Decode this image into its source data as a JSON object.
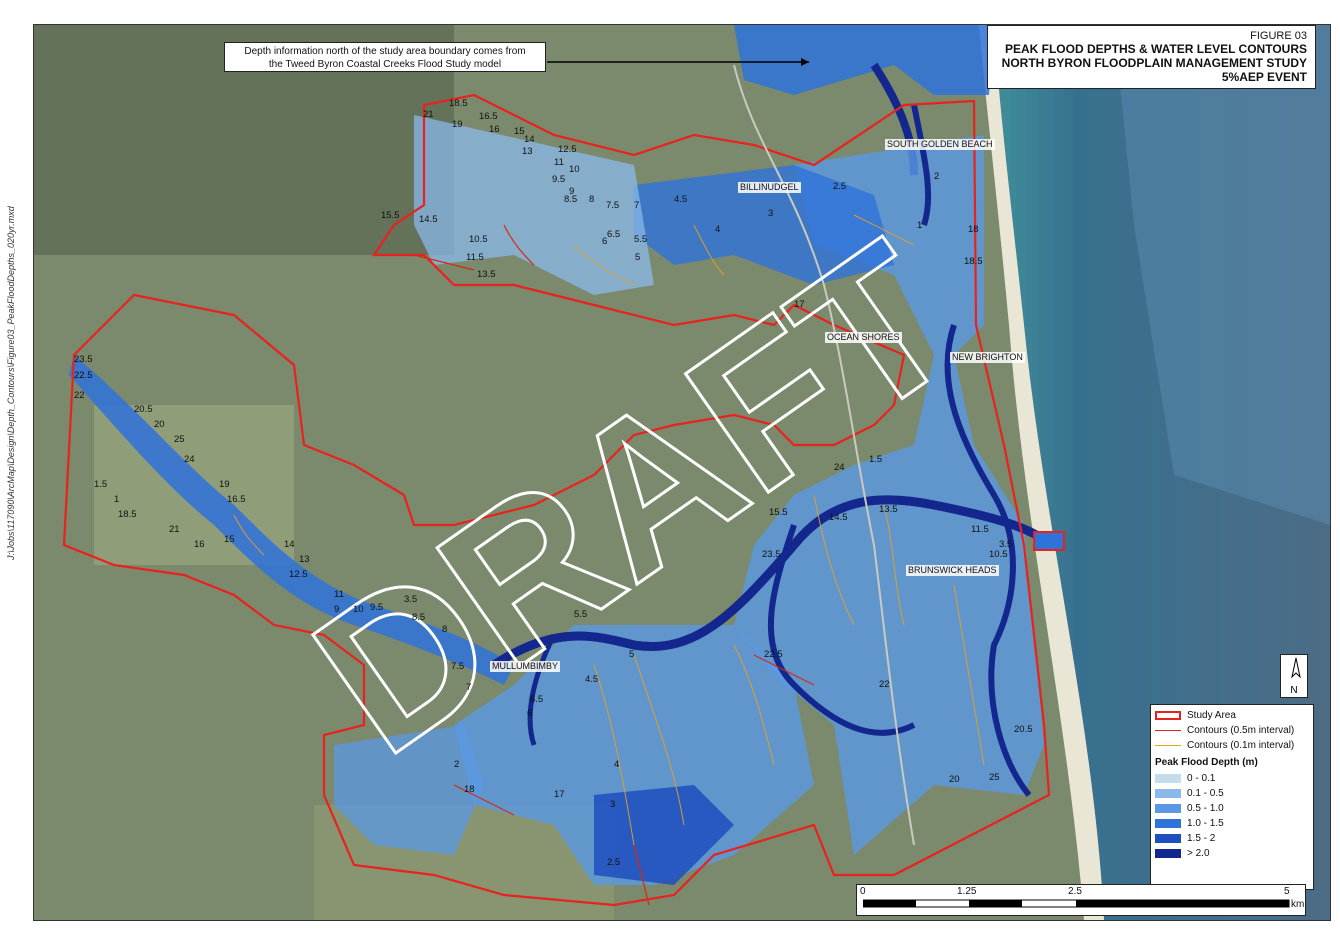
{
  "title": {
    "figure_no": "FIGURE 03",
    "lines": [
      "PEAK FLOOD DEPTHS & WATER LEVEL CONTOURS",
      "NORTH BYRON FLOODPLAIN MANAGEMENT STUDY",
      "5%AEP EVENT"
    ]
  },
  "callout": {
    "line1": "Depth information north of the study area boundary comes from",
    "line2": "the Tweed Byron Coastal Creeks Flood Study model"
  },
  "watermark": "DRAFT",
  "place_labels": {
    "south_golden_beach": "SOUTH GOLDEN BEACH",
    "billinudgel": "BILLINUDGEL",
    "ocean_shores": "OCEAN SHORES",
    "new_brighton": "NEW BRIGHTON",
    "brunswick_heads": "BRUNSWICK HEADS",
    "mullumbimby": "MULLUMBIMBY"
  },
  "contour_labels": [
    "18.5",
    "21",
    "19",
    "16.5",
    "16",
    "15",
    "14",
    "13",
    "12.5",
    "11",
    "10",
    "9.5",
    "9",
    "8.5",
    "8",
    "7.5",
    "7",
    "6.5",
    "6",
    "5.5",
    "5",
    "4.5",
    "4",
    "3",
    "2.5",
    "2",
    "18",
    "17",
    "15.5",
    "14.5",
    "13.5",
    "11.5",
    "10.5",
    "3.5",
    "23.5",
    "22.5",
    "22",
    "20.5",
    "20",
    "25",
    "24",
    "1.5",
    "1"
  ],
  "legend": {
    "study_area": "Study Area",
    "contour_major": "Contours (0.5m interval)",
    "contour_minor": "Contours (0.1m interval)",
    "depth_heading": "Peak Flood Depth (m)",
    "classes": [
      {
        "label": "0 - 0.1",
        "color": "#c3dcee"
      },
      {
        "label": "0.1 - 0.5",
        "color": "#8ab8ea"
      },
      {
        "label": "0.5 - 1.0",
        "color": "#5a98e4"
      },
      {
        "label": "1.0 - 1.5",
        "color": "#2f72da"
      },
      {
        "label": "1.5 - 2",
        "color": "#1f4fbf"
      },
      {
        "label": "> 2.0",
        "color": "#14278f"
      }
    ]
  },
  "colors": {
    "study_area": "#e8221f",
    "contour_major": "#d42a10",
    "contour_minor": "#e7a028"
  },
  "north_arrow": "N",
  "scale_bar": {
    "ticks": [
      "0",
      "1.25",
      "2.5",
      "5"
    ],
    "unit": "km"
  },
  "file_path": "J:\\Jobs\\117090\\ArcMap\\Design\\Depth_Contours\\Figure03_PeakFloodDepths_020yr.mxd",
  "icons": {
    "north": "north-arrow-icon"
  }
}
